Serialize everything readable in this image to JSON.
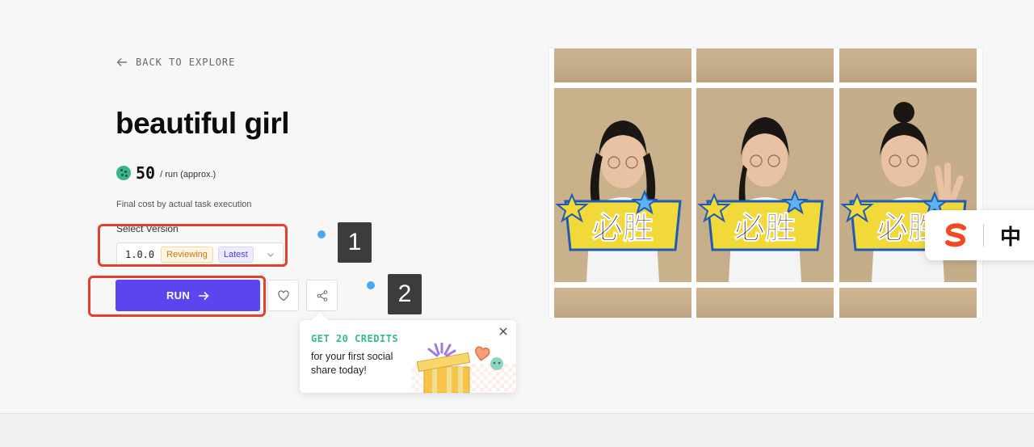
{
  "nav": {
    "back_label": "BACK TO EXPLORE"
  },
  "model": {
    "title": "beautiful girl",
    "cost_amount": "50",
    "cost_unit": "/ run (approx.)",
    "final_cost_note": "Final cost by actual task execution"
  },
  "version": {
    "label": "Select Version",
    "value": "1.0.0",
    "badges": [
      "Reviewing",
      "Latest"
    ]
  },
  "actions": {
    "run_label": "RUN"
  },
  "annotations": {
    "marker_1": "1",
    "marker_2": "2"
  },
  "promo": {
    "title": "GET 20 CREDITS",
    "text": "for your first social share today!"
  },
  "gallery": {
    "sign_text": "必胜"
  },
  "ime": {
    "mode_label": "中"
  },
  "colors": {
    "accent": "#5b45ee",
    "highlight_box": "#e2412f",
    "promo_title": "#35b98c",
    "marker_dot": "#4aa8f0"
  }
}
